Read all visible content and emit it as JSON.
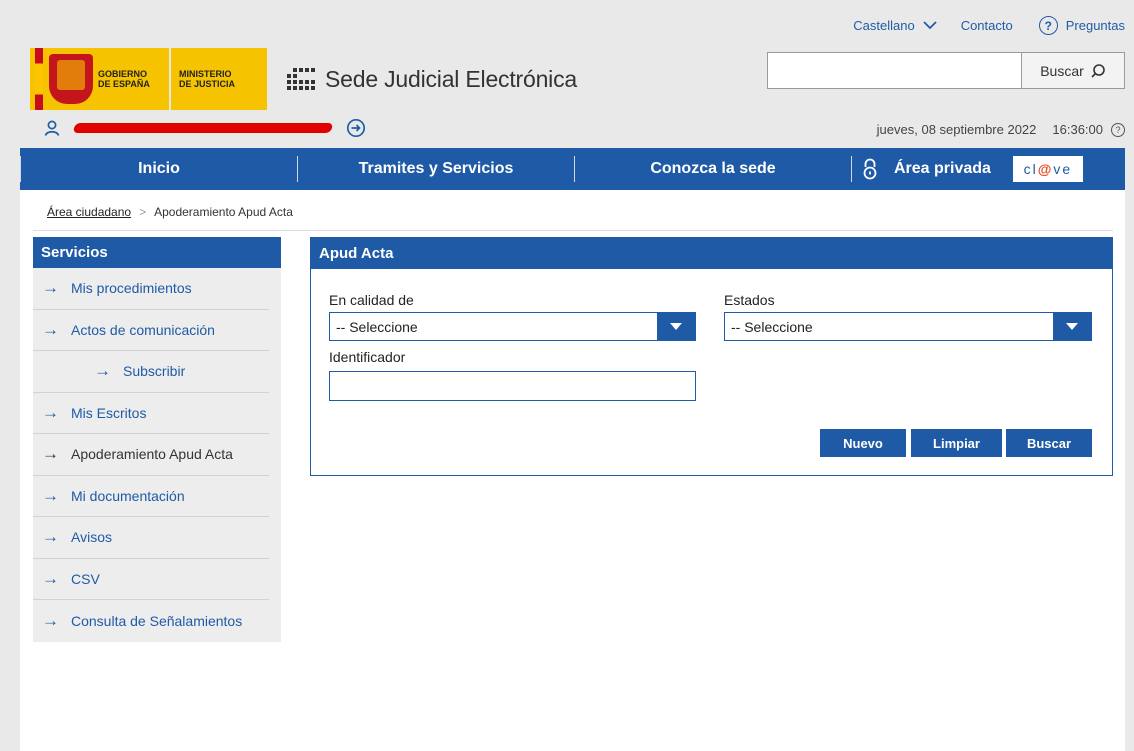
{
  "header": {
    "language": "Castellano",
    "contact": "Contacto",
    "faq": "Preguntas",
    "gob_line1": "GOBIERNO",
    "gob_line2": "DE ESPAÑA",
    "min_line1": "MINISTERIO",
    "min_line2": "DE JUSTICIA",
    "site_title": "Sede Judicial Electrónica",
    "search_value": "",
    "search_button": "Buscar",
    "date": "jueves, 08 septiembre 2022",
    "time": "16:36:00"
  },
  "nav": {
    "items": [
      "Inicio",
      "Tramites y Servicios",
      "Conozca la sede",
      "Área privada"
    ],
    "clave_pre": "cl",
    "clave_mid": "@",
    "clave_post": "ve"
  },
  "breadcrumb": {
    "parent": "Área ciudadano",
    "current": "Apoderamiento Apud Acta"
  },
  "sidebar": {
    "title": "Servicios",
    "items": [
      "Mis procedimientos",
      "Actos de comunicación",
      "Subscribir",
      "Mis Escritos",
      "Apoderamiento Apud Acta",
      "Mi documentación",
      "Avisos",
      "CSV",
      "Consulta de Señalamientos"
    ]
  },
  "panel": {
    "title": "Apud Acta",
    "calidad_label": "En calidad de",
    "calidad_value": "-- Seleccione",
    "estados_label": "Estados",
    "estados_value": "-- Seleccione",
    "identificador_label": "Identificador",
    "identificador_value": "",
    "btn_nuevo": "Nuevo",
    "btn_limpiar": "Limpiar",
    "btn_buscar": "Buscar"
  },
  "colors": {
    "brand_blue": "#1f5aa6",
    "gov_yellow": "#f6c300"
  }
}
